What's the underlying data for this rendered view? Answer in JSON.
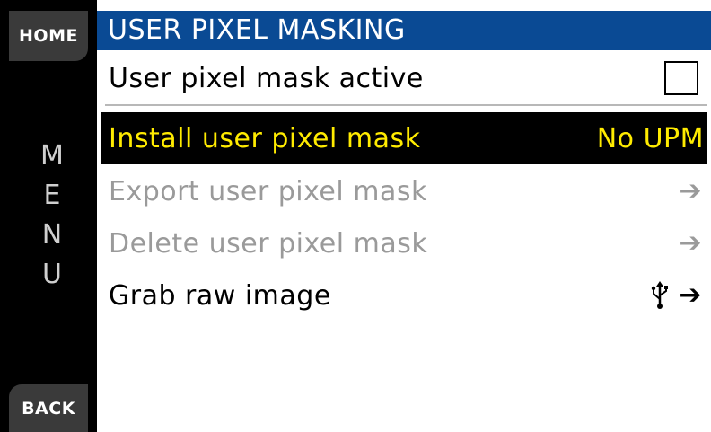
{
  "sidebar": {
    "home_label": "HOME",
    "back_label": "BACK",
    "menu_letters": [
      "M",
      "E",
      "N",
      "U"
    ]
  },
  "header": {
    "title": "USER PIXEL MASKING"
  },
  "items": [
    {
      "label": "User pixel mask active",
      "control": "checkbox",
      "checked": false
    },
    {
      "label": "Install user pixel mask",
      "value": "No UPM",
      "selected": true
    },
    {
      "label": "Export user pixel mask",
      "disabled": true,
      "icon": "arrow-right-icon"
    },
    {
      "label": "Delete user pixel mask",
      "disabled": true,
      "icon": "arrow-right-icon"
    },
    {
      "label": "Grab raw image",
      "icons": [
        "usb-icon",
        "arrow-right-icon"
      ]
    }
  ],
  "colors": {
    "title_bar": "#0a4a94",
    "selected_text": "#ffeb00",
    "disabled_text": "#9a9a9a"
  }
}
